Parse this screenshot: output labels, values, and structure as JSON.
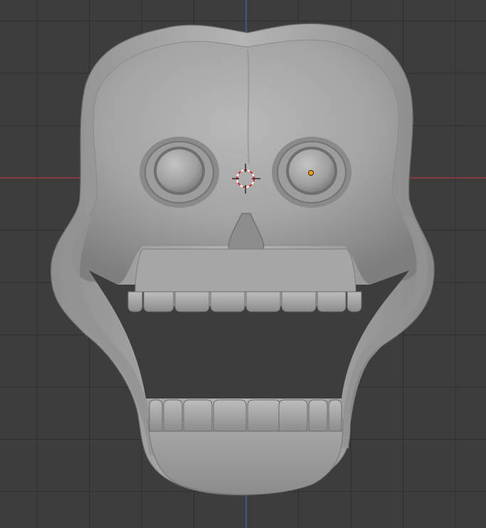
{
  "viewport": {
    "view": "front-orthographic",
    "background_color": "#3d3d3d",
    "grid_minor_color": "#353535",
    "grid_major_color": "#2e2e2e",
    "x_axis_color": "#9b3b3b",
    "z_axis_color": "#3a66a8",
    "mesh_color": "#a3a3a3"
  },
  "scene": {
    "object": "skull-mesh",
    "shading": "solid",
    "cursor": "3d-cursor",
    "origin_marker": "object-origin",
    "origin_color": "#ff9a1f",
    "cursor_color": "#e02626"
  }
}
